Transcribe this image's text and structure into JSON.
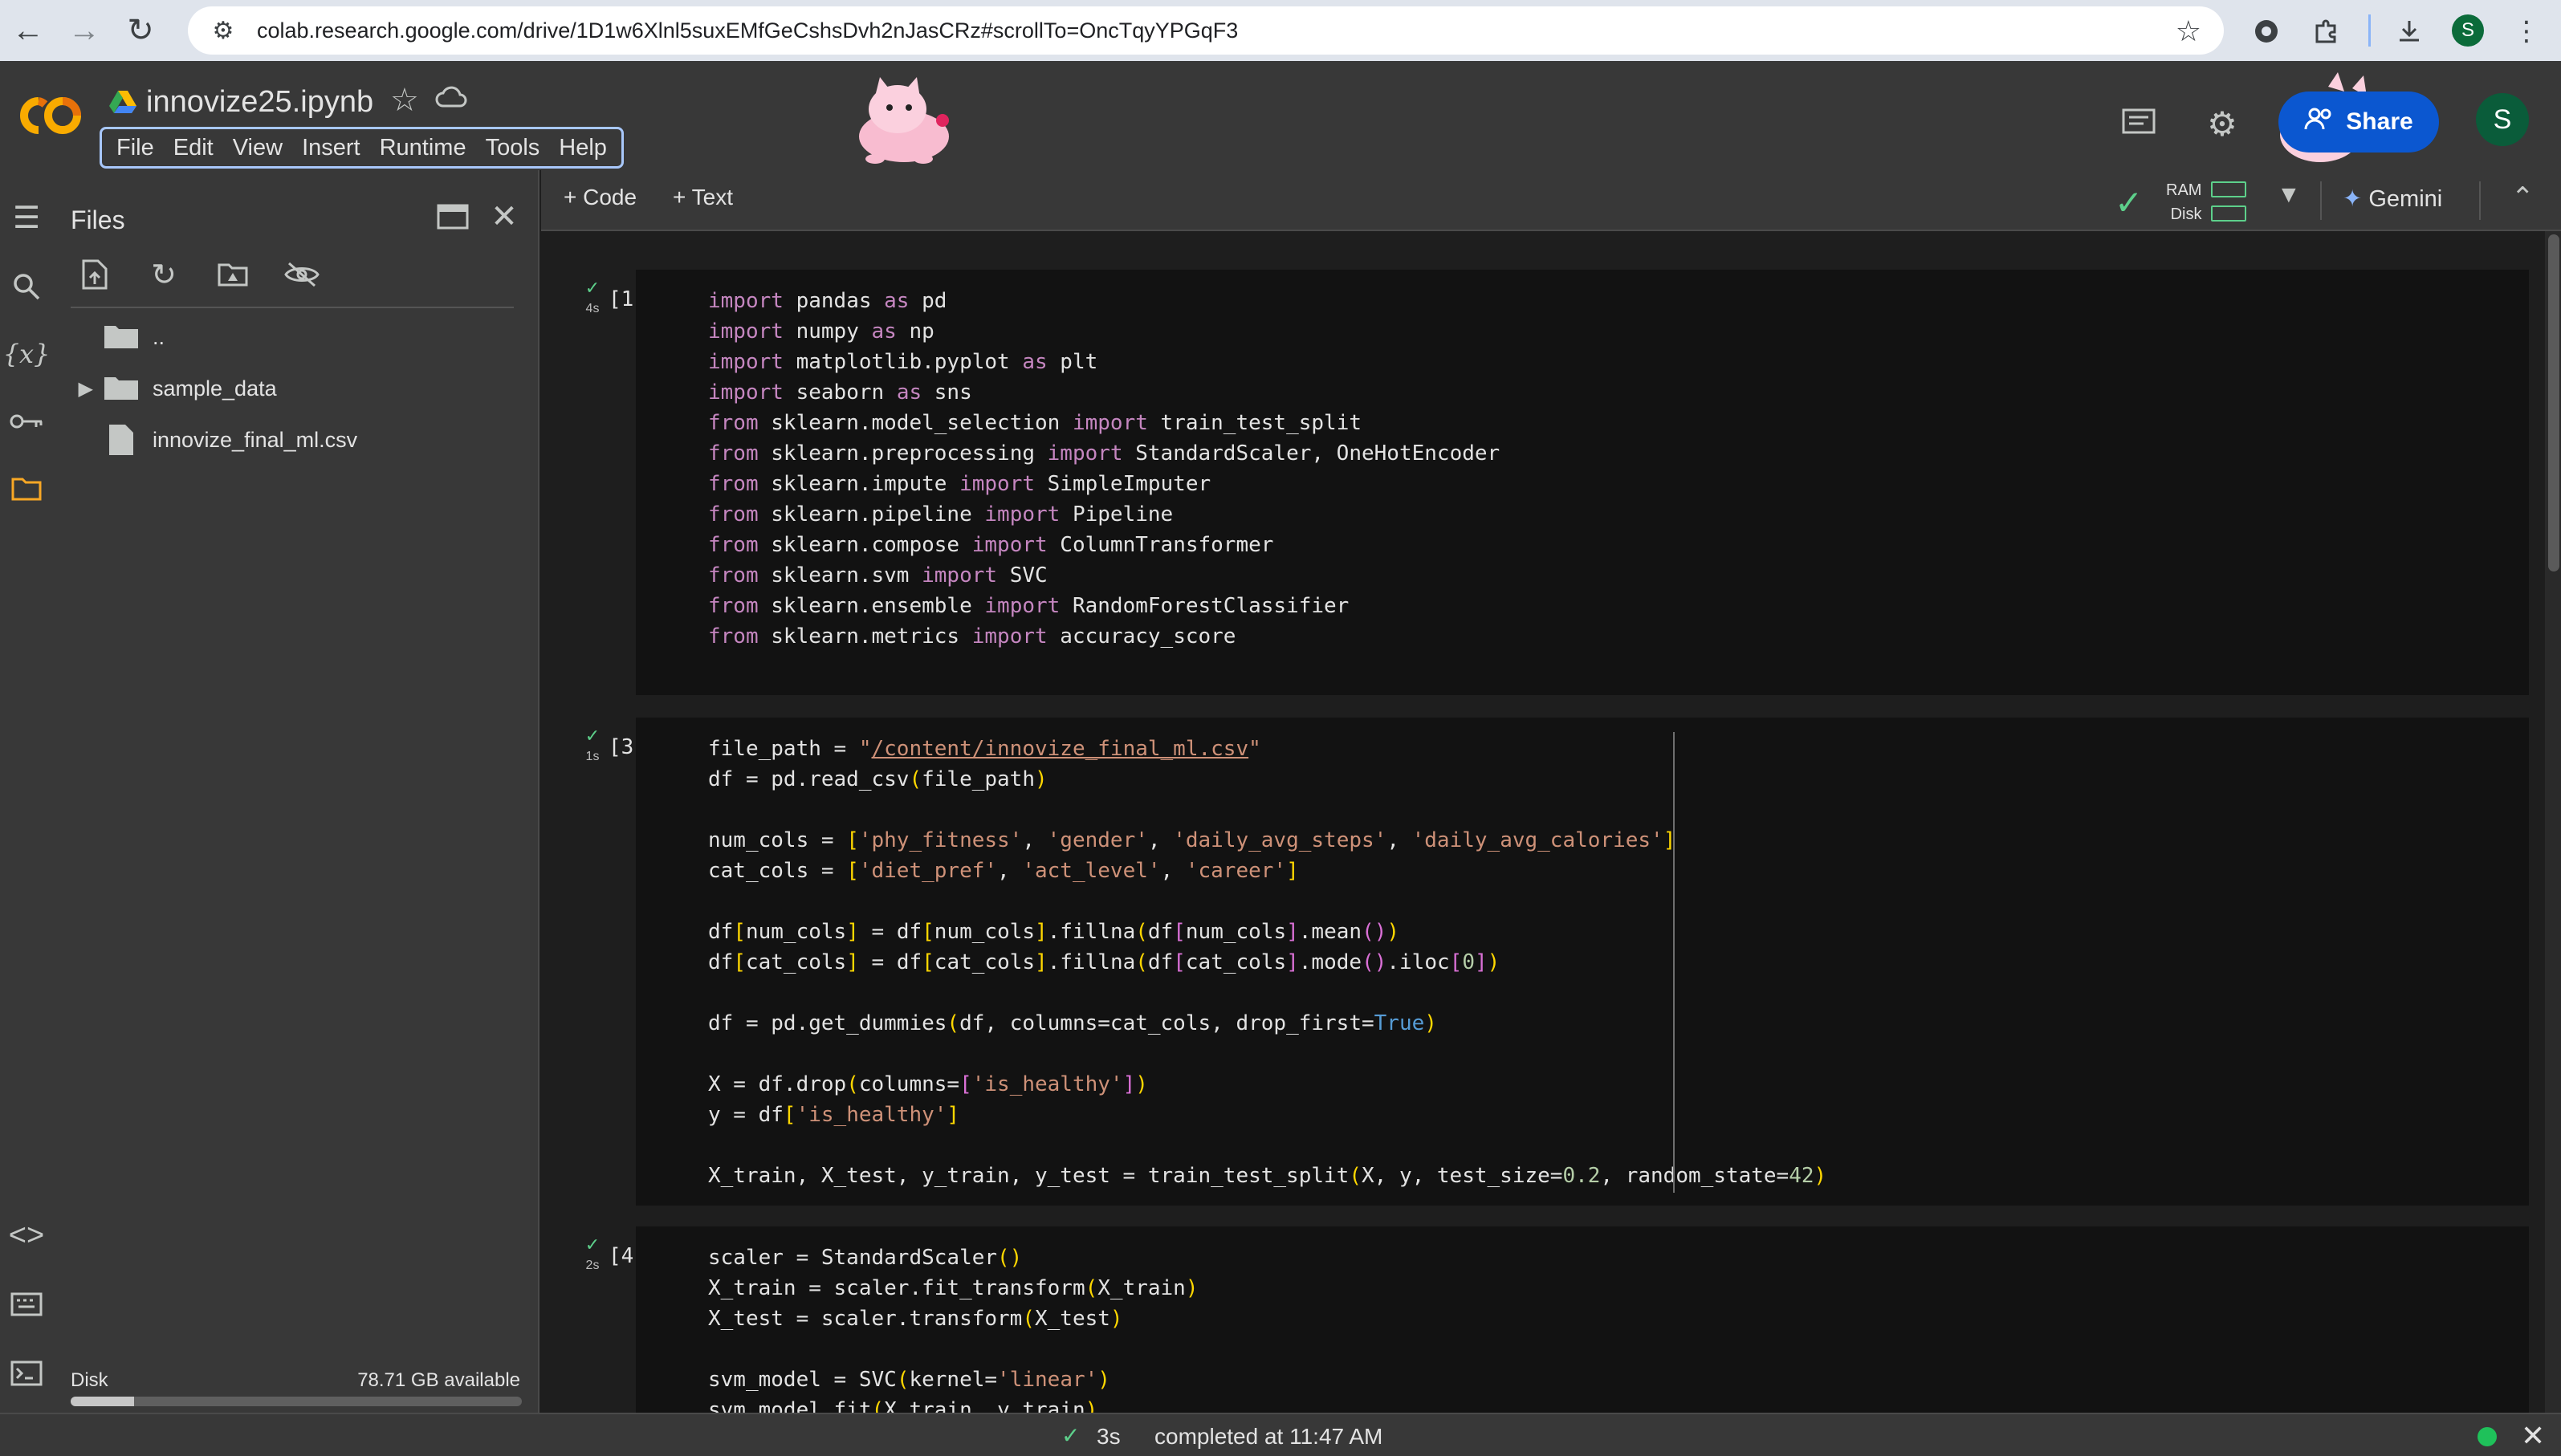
{
  "browser": {
    "url": "colab.research.google.com/drive/1D1w6Xlnl5suxEMfGeCshsDvh2nJasCRz#scrollTo=OncTqyYPGqF3",
    "profile_initial": "S"
  },
  "header": {
    "notebook_title": "innovize25.ipynb",
    "menu": [
      "File",
      "Edit",
      "View",
      "Insert",
      "Runtime",
      "Tools",
      "Help"
    ],
    "share_label": "Share",
    "user_initial": "S"
  },
  "files_panel": {
    "title": "Files",
    "items": [
      {
        "name": "..",
        "type": "folder-up"
      },
      {
        "name": "sample_data",
        "type": "folder"
      },
      {
        "name": "innovize_final_ml.csv",
        "type": "file"
      }
    ],
    "disk_label": "Disk",
    "disk_available": "78.71 GB available",
    "disk_used_fraction": 0.14
  },
  "toolbar": {
    "add_code": "Code",
    "add_text": "Text",
    "ram_label": "RAM",
    "disk_label": "Disk",
    "gemini_label": "Gemini"
  },
  "cells": [
    {
      "count": "[1]",
      "time": "4s"
    },
    {
      "count": "[3]",
      "time": "1s"
    },
    {
      "count": "[4]",
      "time": "2s"
    }
  ],
  "statusbar": {
    "elapsed": "3s",
    "message": "completed at 11:47 AM"
  },
  "colors": {
    "accent_blue": "#0b57d0",
    "success_green": "#5dd08b",
    "folder_active": "#f9a825"
  }
}
